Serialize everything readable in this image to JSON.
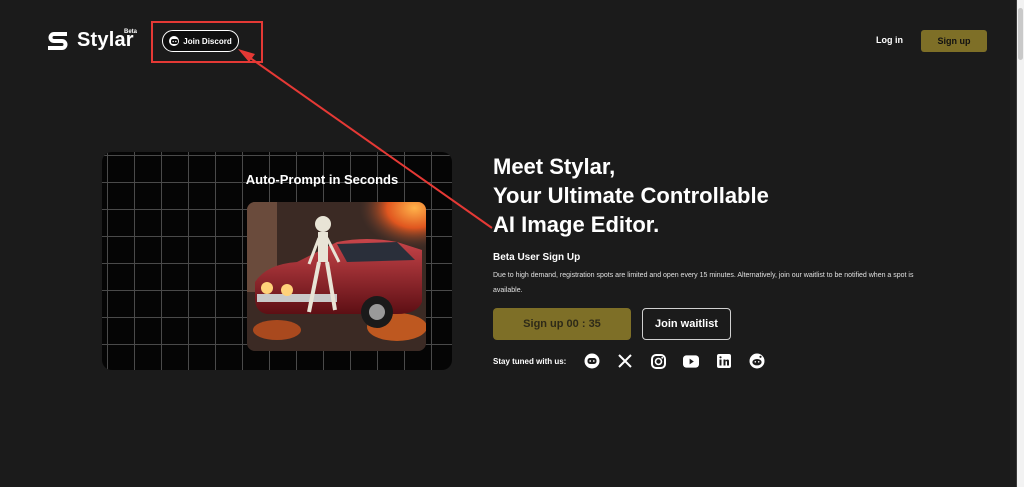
{
  "header": {
    "brand": "Stylar",
    "badge": "Beta",
    "discord_label": "Join Discord",
    "login_label": "Log in",
    "signup_label": "Sign up"
  },
  "demo": {
    "title": "Auto-Prompt in Seconds"
  },
  "hero": {
    "title_line1": "Meet Stylar,",
    "title_line2": "Your Ultimate Controllable",
    "title_line3": "AI Image Editor.",
    "signup_heading": "Beta User Sign Up",
    "description": "Due to high demand, registration spots are limited and open every 15 minutes. Alternatively, join our waitlist to be notified when a spot is available.",
    "signup_button": "Sign up 00 : 35",
    "waitlist_button": "Join waitlist",
    "stay_tuned": "Stay tuned with us:"
  },
  "socials": [
    "discord-icon",
    "x-icon",
    "instagram-icon",
    "youtube-icon",
    "linkedin-icon",
    "reddit-icon"
  ],
  "colors": {
    "background": "#1b1b1b",
    "accent": "#7e6f27",
    "annotation": "#e53935"
  }
}
